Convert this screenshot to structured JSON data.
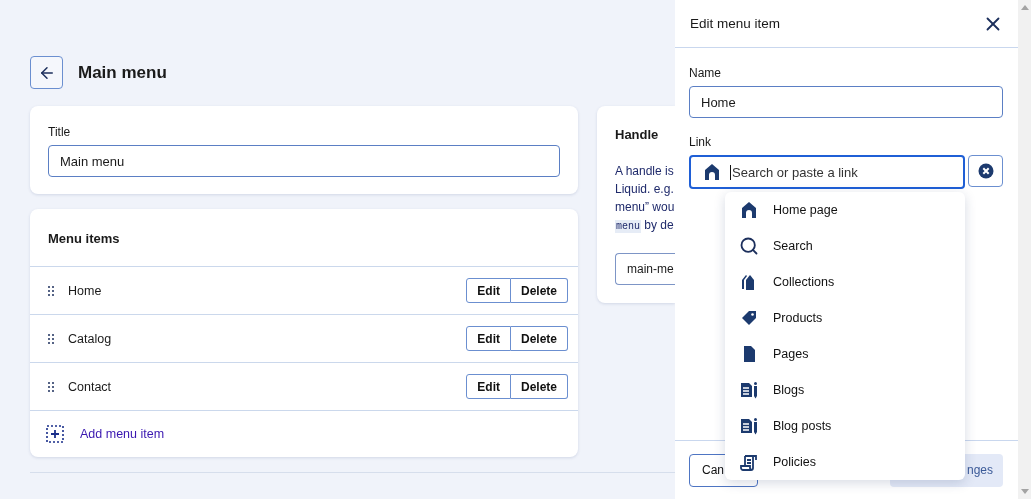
{
  "page": {
    "title": "Main menu"
  },
  "title_card": {
    "label": "Title",
    "value": "Main menu"
  },
  "menu_items": {
    "heading": "Menu items",
    "items": [
      {
        "name": "Home",
        "edit": "Edit",
        "delete": "Delete"
      },
      {
        "name": "Catalog",
        "edit": "Edit",
        "delete": "Delete"
      },
      {
        "name": "Contact",
        "edit": "Edit",
        "delete": "Delete"
      }
    ],
    "add": "Add menu item"
  },
  "handle_card": {
    "heading": "Handle",
    "lines": [
      "A handle is",
      "Liquid. e.g.",
      "menu” wou"
    ],
    "code": "menu",
    "last_line": "by de",
    "value": "main-me"
  },
  "drawer": {
    "title": "Edit menu item",
    "name_label": "Name",
    "name_value": "Home",
    "link_label": "Link",
    "link_placeholder": "Search or paste a link",
    "link_focused": true,
    "dropdown": [
      {
        "kind": "home",
        "label": "Home page"
      },
      {
        "kind": "search",
        "label": "Search"
      },
      {
        "kind": "collection",
        "label": "Collections"
      },
      {
        "kind": "product",
        "label": "Products"
      },
      {
        "kind": "page",
        "label": "Pages"
      },
      {
        "kind": "blog",
        "label": "Blogs"
      },
      {
        "kind": "blog",
        "label": "Blog posts"
      },
      {
        "kind": "policy",
        "label": "Policies"
      }
    ],
    "cancel": "Can",
    "apply": "nges"
  }
}
